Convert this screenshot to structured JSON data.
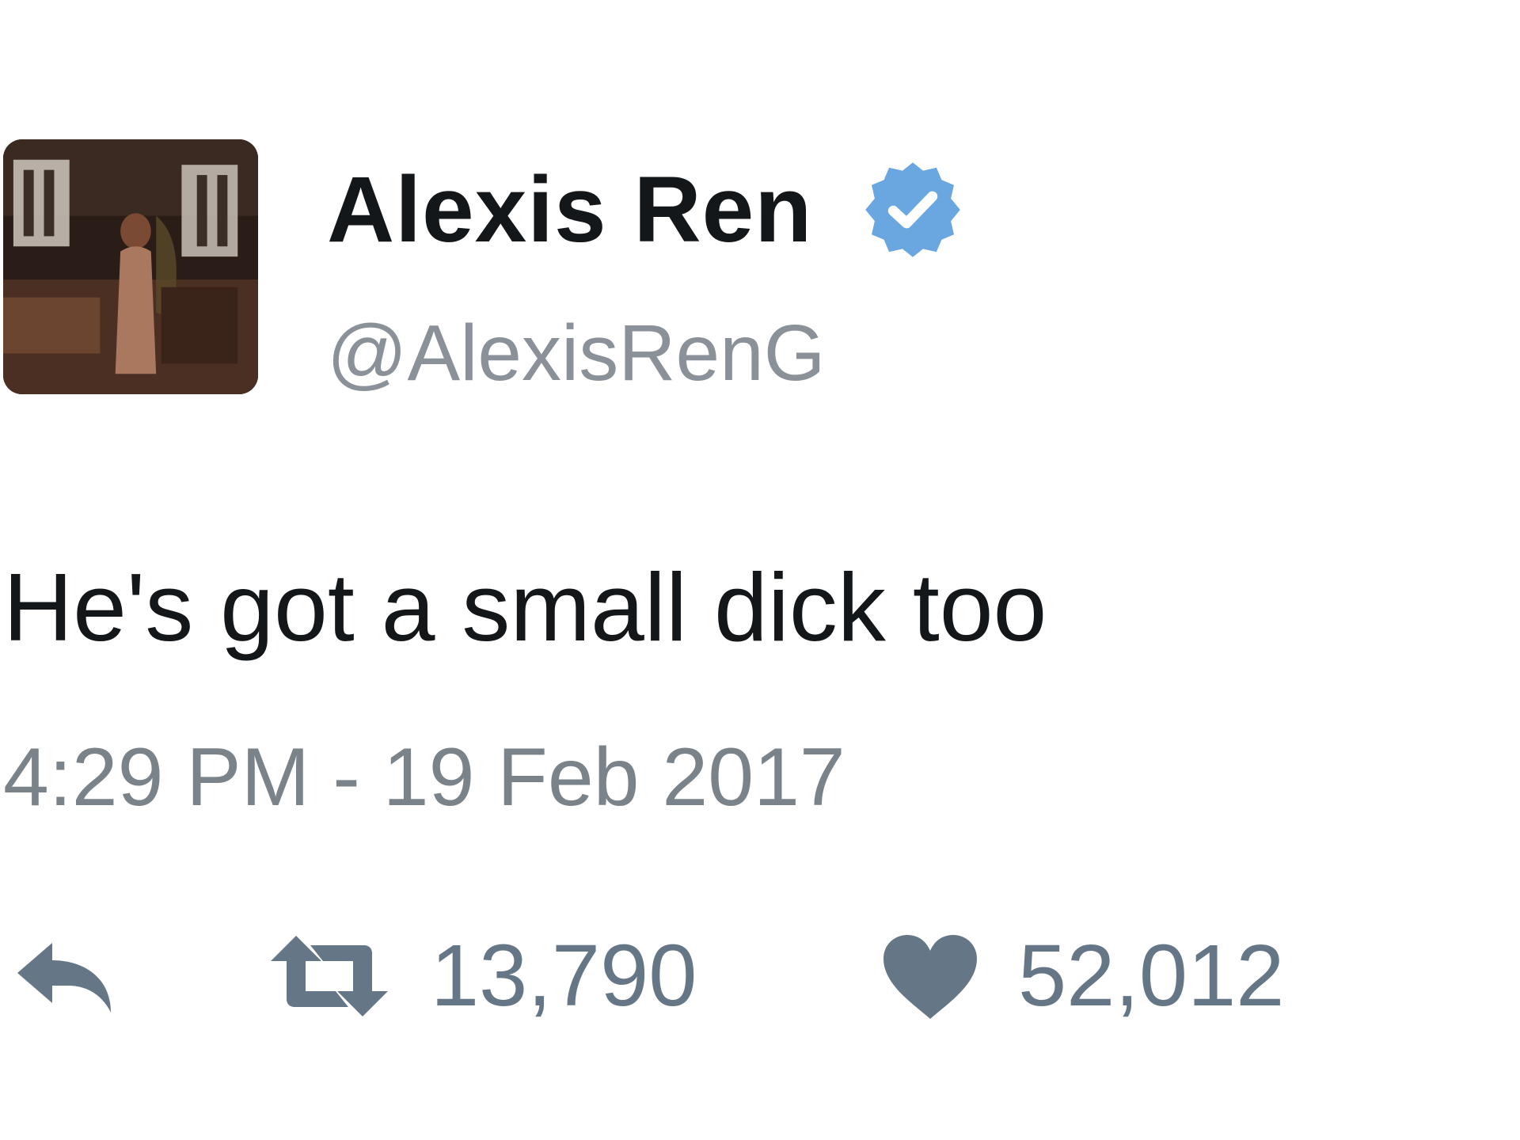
{
  "tweet": {
    "author": {
      "display_name": "Alexis Ren",
      "handle": "@AlexisRenG",
      "verified": true
    },
    "text": "He's got a small dick too",
    "timestamp": "4:29 PM - 19 Feb 2017",
    "actions": {
      "reply_icon": "reply-icon",
      "retweet_icon": "retweet-icon",
      "retweet_count": "13,790",
      "like_icon": "heart-icon",
      "like_count": "52,012"
    }
  },
  "colors": {
    "text_primary": "#14171a",
    "text_secondary": "#8a9199",
    "action_gray": "#657786",
    "verified_blue": "#6aa7e0"
  }
}
